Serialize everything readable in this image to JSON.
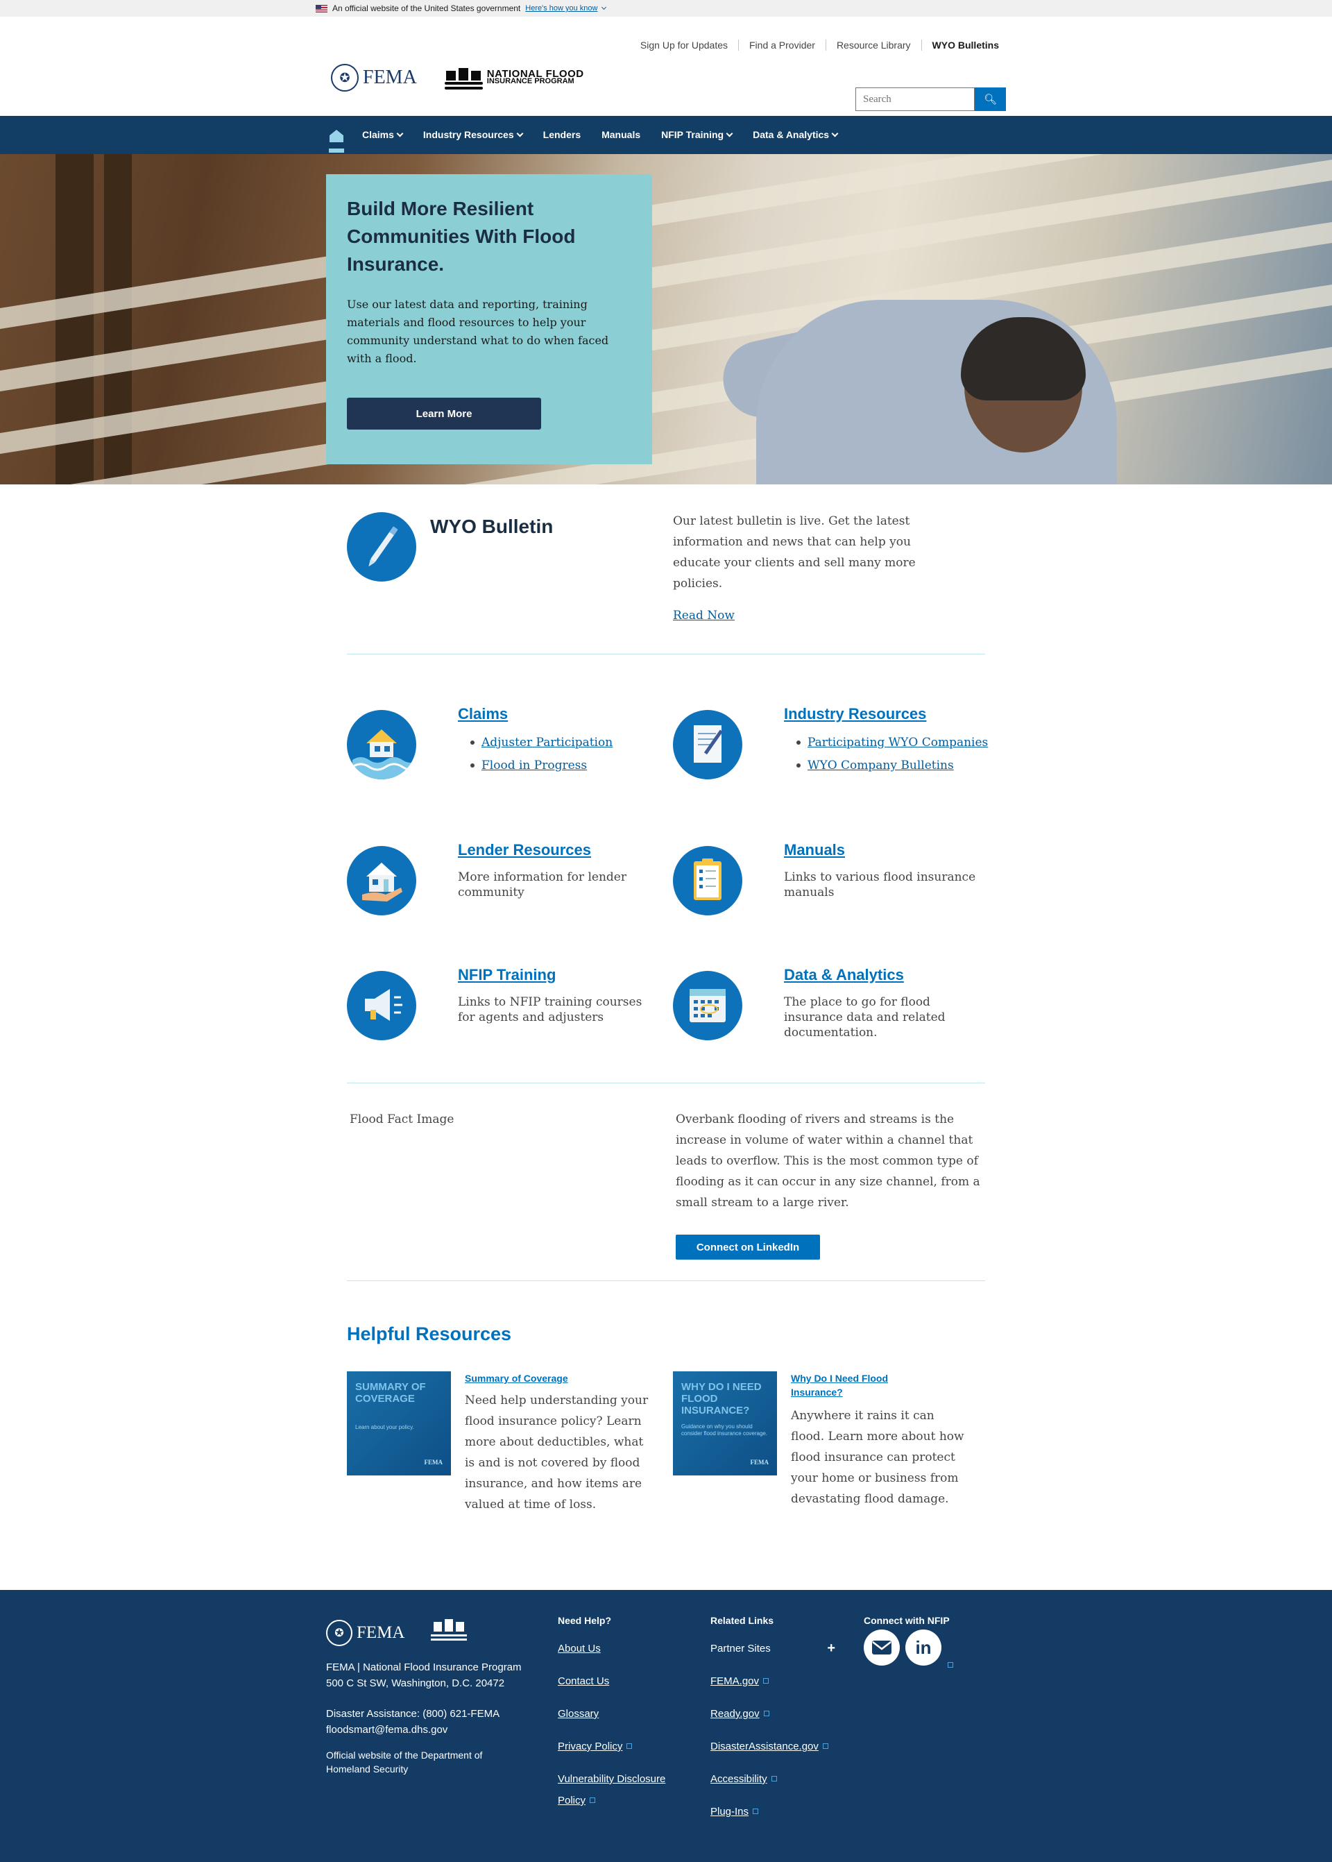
{
  "gov_banner": {
    "text": "An official website of the United States government",
    "link": "Here's how you know"
  },
  "utility_nav": [
    "Sign Up for Updates",
    "Find a Provider",
    "Resource Library",
    "WYO Bulletins"
  ],
  "logos": {
    "fema": "FEMA",
    "nfip_line1": "NATIONAL FLOOD",
    "nfip_line2": "INSURANCE PROGRAM"
  },
  "search": {
    "placeholder": "Search"
  },
  "nav": [
    {
      "label": "Claims",
      "dropdown": true
    },
    {
      "label": "Industry Resources",
      "dropdown": true
    },
    {
      "label": "Lenders",
      "dropdown": false
    },
    {
      "label": "Manuals",
      "dropdown": false
    },
    {
      "label": "NFIP Training",
      "dropdown": true
    },
    {
      "label": "Data & Analytics",
      "dropdown": true
    }
  ],
  "hero": {
    "title": "Build More Resilient Communities With Flood Insurance.",
    "text": "Use our latest data and reporting, training materials and flood resources to help your community understand what to do when faced with a flood.",
    "button": "Learn More"
  },
  "wyo": {
    "title": "WYO Bulletin",
    "text": "Our latest bulletin is live. Get the latest information and news that can help you educate your clients and sell many more policies.",
    "link": "Read Now"
  },
  "cards": {
    "claims": {
      "title": "Claims",
      "links": [
        "Adjuster Participation",
        "Flood in Progress"
      ]
    },
    "industry": {
      "title": "Industry Resources",
      "links": [
        "Participating WYO Companies",
        "WYO Company Bulletins"
      ]
    },
    "lender": {
      "title": "Lender Resources",
      "desc": "More information for lender community"
    },
    "manuals": {
      "title": "Manuals",
      "desc": "Links to various flood insurance manuals"
    },
    "training": {
      "title": "NFIP Training",
      "desc": "Links to NFIP training courses for agents and adjusters"
    },
    "data": {
      "title": "Data & Analytics",
      "desc": "The place to go for flood insurance data and related documentation."
    }
  },
  "flood_fact": {
    "image_label": "Flood Fact Image",
    "text": "Overbank flooding of rivers and streams is the increase in volume of water within a channel that leads to overflow. This is the most common type of flooding as it can occur in any size channel, from a small stream to a large river.",
    "button": "Connect on LinkedIn"
  },
  "helpful": {
    "title": "Helpful Resources",
    "items": [
      {
        "thumb_title": "SUMMARY OF COVERAGE",
        "thumb_sub": "Learn about your policy.",
        "thumb_brand": "FEMA",
        "title": "Summary of Coverage",
        "text": "Need help understanding your flood insurance policy? Learn more about deductibles, what is and is not covered by flood insurance, and how items are valued at time of loss."
      },
      {
        "thumb_title": "WHY DO I NEED FLOOD INSURANCE?",
        "thumb_sub": "Guidance on why you should consider flood insurance coverage.",
        "thumb_brand": "FEMA",
        "title": "Why Do I Need Flood Insurance?",
        "text": "Anywhere it rains it can flood. Learn more about how flood insurance can protect your home or business from devastating flood damage."
      }
    ]
  },
  "footer": {
    "fema": "FEMA",
    "address1": "FEMA | National Flood Insurance Program",
    "address2": "500 C St SW, Washington, D.C. 20472",
    "phone": "Disaster Assistance: (800) 621-FEMA",
    "email": "floodsmart@fema.dhs.gov",
    "official1": "Official website of the Department of",
    "official2": "Homeland Security",
    "need_help": {
      "title": "Need Help?",
      "links": [
        "About Us",
        "Contact Us",
        "Glossary",
        "Privacy Policy",
        "Vulnerability Disclosure",
        "Policy"
      ]
    },
    "related": {
      "title": "Related Links",
      "partner": "Partner Sites",
      "links": [
        "FEMA.gov",
        "Ready.gov",
        "DisasterAssistance.gov",
        "Accessibility",
        "Plug-Ins"
      ]
    },
    "connect": {
      "title": "Connect with NFIP",
      "linkedin": "in"
    }
  },
  "colors": {
    "nav": "#123d65",
    "accent": "#0071bc",
    "hero_box": "#8bcfd4",
    "footer": "#133b64"
  }
}
